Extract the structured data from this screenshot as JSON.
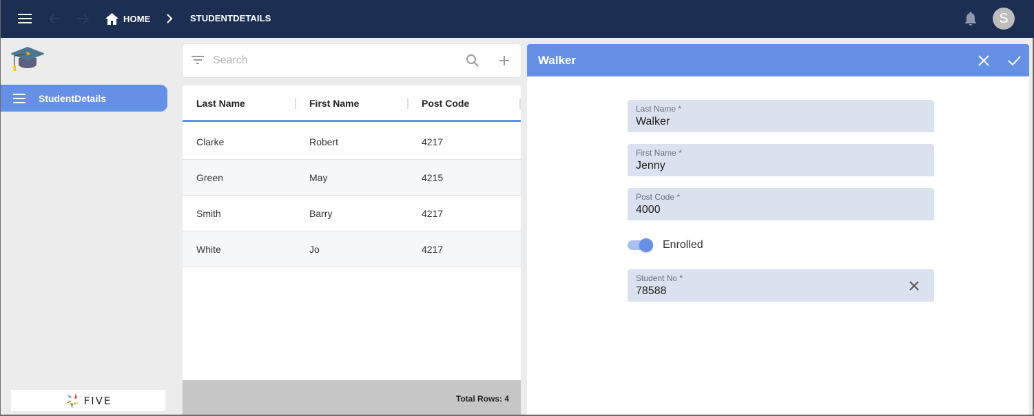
{
  "topbar": {
    "breadcrumb": [
      {
        "label": "HOME",
        "icon": "home-icon"
      },
      {
        "label": "STUDENTDETAILS"
      }
    ],
    "avatar_initial": "S",
    "icons": [
      "menu-icon",
      "arrow-back-icon",
      "arrow-forward-icon",
      "chevron-right-icon",
      "bell-icon"
    ]
  },
  "sidebar": {
    "logo": "graduation-cap-icon",
    "items": [
      {
        "label": "StudentDetails",
        "icon": "menu-icon",
        "active": true
      }
    ],
    "brand": "FIVE"
  },
  "search": {
    "placeholder": "Search",
    "value": ""
  },
  "table": {
    "columns": [
      "Last Name",
      "First Name",
      "Post Code"
    ],
    "rows": [
      [
        "Clarke",
        "Robert",
        "4217"
      ],
      [
        "Green",
        "May",
        "4215"
      ],
      [
        "Smith",
        "Barry",
        "4217"
      ],
      [
        "White",
        "Jo",
        "4217"
      ]
    ],
    "footer": "Total Rows: 4"
  },
  "form": {
    "title": "Walker",
    "fields": [
      {
        "label": "Last Name *",
        "value": "Walker"
      },
      {
        "label": "First Name *",
        "value": "Jenny"
      },
      {
        "label": "Post Code *",
        "value": "4000"
      },
      {
        "label": "Student No *",
        "value": "78588"
      }
    ],
    "toggle": {
      "label": "Enrolled",
      "checked": true
    }
  },
  "colors": {
    "topbar": "#1c2f52",
    "accent": "#6490e6",
    "field_bg": "#dce1f0",
    "footer_bg": "#c6c6c6"
  }
}
